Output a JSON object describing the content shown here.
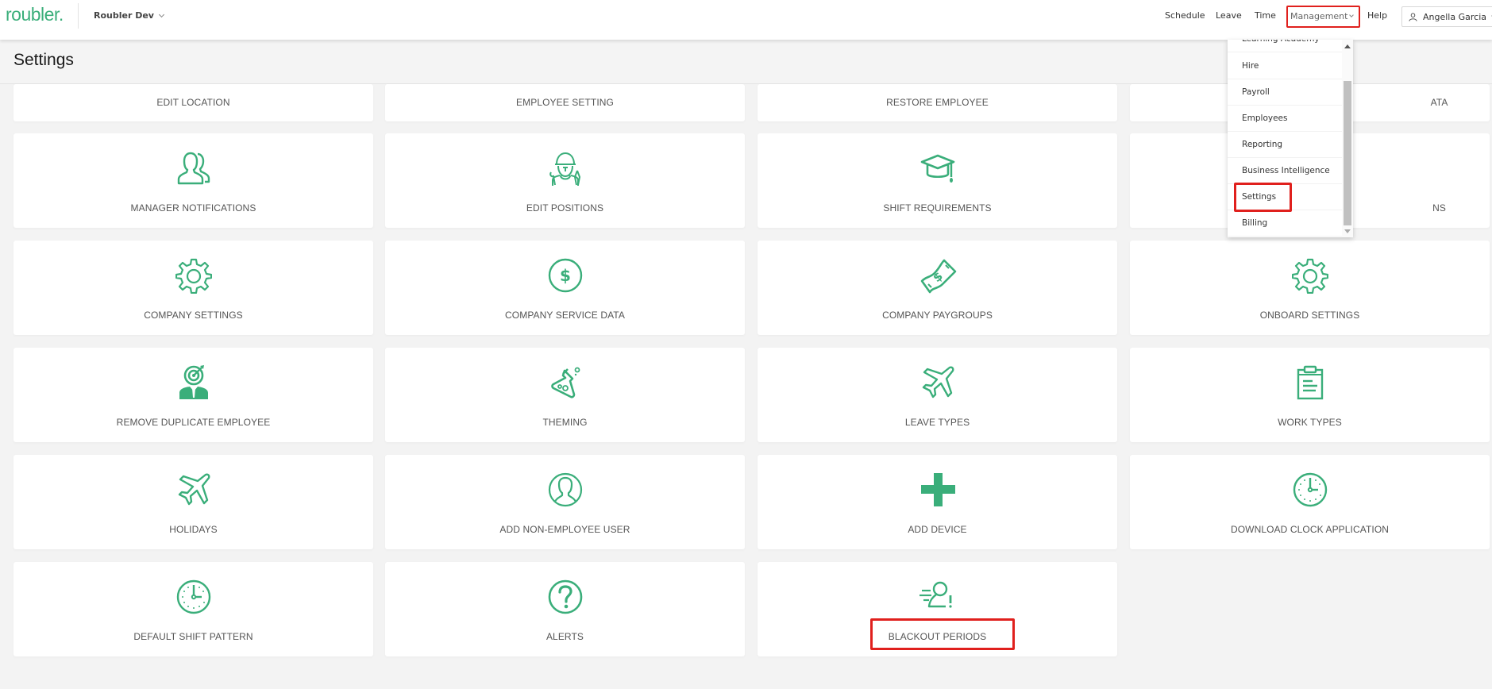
{
  "header": {
    "logo": "roubler.",
    "org_name": "Roubler Dev",
    "nav": {
      "schedule": "Schedule",
      "leave": "Leave",
      "time": "Time",
      "management": "Management",
      "help": "Help"
    },
    "user_name": "Angella Garcia"
  },
  "page": {
    "title": "Settings"
  },
  "management_menu": {
    "items": [
      {
        "label": "Learning Academy"
      },
      {
        "label": "Hire"
      },
      {
        "label": "Payroll"
      },
      {
        "label": "Employees"
      },
      {
        "label": "Reporting"
      },
      {
        "label": "Business Intelligence"
      },
      {
        "label": "Settings",
        "highlighted": true
      },
      {
        "label": "Billing"
      }
    ]
  },
  "cards": [
    {
      "label": "EDIT LOCATION",
      "icon": "none"
    },
    {
      "label": "EMPLOYEE SETTING",
      "icon": "none"
    },
    {
      "label": "RESTORE EMPLOYEE",
      "icon": "none"
    },
    {
      "label": "ATA",
      "icon": "none"
    },
    {
      "label": "MANAGER NOTIFICATIONS",
      "icon": "users-icon"
    },
    {
      "label": "EDIT POSITIONS",
      "icon": "worker-icon"
    },
    {
      "label": "SHIFT REQUIREMENTS",
      "icon": "graduation-cap-icon"
    },
    {
      "label": "NS",
      "icon": "none"
    },
    {
      "label": "COMPANY SETTINGS",
      "icon": "gear-icon"
    },
    {
      "label": "COMPANY SERVICE DATA",
      "icon": "dollar-circle-icon"
    },
    {
      "label": "COMPANY PAYGROUPS",
      "icon": "money-bill-icon"
    },
    {
      "label": "ONBOARD SETTINGS",
      "icon": "gear-icon"
    },
    {
      "label": "REMOVE DUPLICATE EMPLOYEE",
      "icon": "target-person-icon"
    },
    {
      "label": "THEMING",
      "icon": "flask-icon"
    },
    {
      "label": "LEAVE TYPES",
      "icon": "airplane-icon"
    },
    {
      "label": "WORK TYPES",
      "icon": "clipboard-icon"
    },
    {
      "label": "HOLIDAYS",
      "icon": "airplane-icon"
    },
    {
      "label": "ADD NON-EMPLOYEE USER",
      "icon": "user-circle-icon"
    },
    {
      "label": "ADD DEVICE",
      "icon": "plus-icon"
    },
    {
      "label": "DOWNLOAD CLOCK APPLICATION",
      "icon": "clock-icon"
    },
    {
      "label": "DEFAULT SHIFT PATTERN",
      "icon": "clock-icon"
    },
    {
      "label": "ALERTS",
      "icon": "question-circle-icon"
    },
    {
      "label": "BLACKOUT PERIODS",
      "icon": "user-alert-icon",
      "highlighted": true
    }
  ],
  "colors": {
    "brand": "#3aae7a",
    "highlight": "#e0201d"
  }
}
